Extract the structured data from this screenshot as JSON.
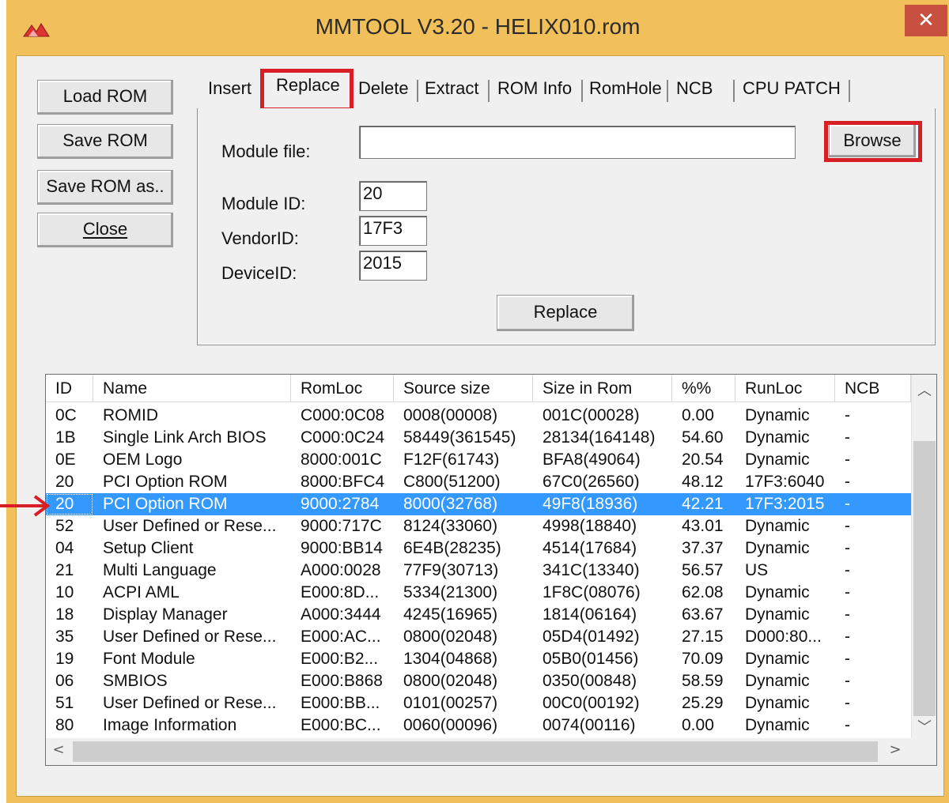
{
  "window": {
    "title": "MMTOOL V3.20 - HELIX010.rom",
    "close_glyph": "✕"
  },
  "left_buttons": {
    "load_rom": "Load ROM",
    "save_rom": "Save ROM",
    "save_rom_as": "Save ROM as..",
    "close": "Close"
  },
  "tabs": [
    {
      "label": "Insert"
    },
    {
      "label": "Replace",
      "active": true,
      "highlighted": true
    },
    {
      "label": "Delete"
    },
    {
      "label": "Extract"
    },
    {
      "label": "ROM Info"
    },
    {
      "label": "RomHole"
    },
    {
      "label": "NCB"
    },
    {
      "label": "CPU PATCH"
    }
  ],
  "replace_panel": {
    "module_file_label": "Module file:",
    "module_file_value": "",
    "browse_label": "Browse",
    "module_id_label": "Module ID:",
    "module_id_value": "20",
    "vendor_id_label": "VendorID:",
    "vendor_id_value": "17F3",
    "device_id_label": "DeviceID:",
    "device_id_value": "2015",
    "replace_button": "Replace"
  },
  "module_table": {
    "columns": [
      "ID",
      "Name",
      "RomLoc",
      "Source size",
      "Size in Rom",
      "%%",
      "RunLoc",
      "NCB"
    ],
    "rows": [
      [
        "0C",
        "ROMID",
        "C000:0C08",
        "0008(00008)",
        "001C(00028)",
        "0.00",
        "Dynamic",
        "-"
      ],
      [
        "1B",
        "Single Link Arch BIOS",
        "C000:0C24",
        "58449(361545)",
        "28134(164148)",
        "54.60",
        "Dynamic",
        "-"
      ],
      [
        "0E",
        "OEM Logo",
        "8000:001C",
        "F12F(61743)",
        "BFA8(49064)",
        "20.54",
        "Dynamic",
        "-"
      ],
      [
        "20",
        "PCI Option ROM",
        "8000:BFC4",
        "C800(51200)",
        "67C0(26560)",
        "48.12",
        "17F3:6040",
        "-"
      ],
      [
        "20",
        "PCI Option ROM",
        "9000:2784",
        "8000(32768)",
        "49F8(18936)",
        "42.21",
        "17F3:2015",
        "-"
      ],
      [
        "52",
        "User Defined or Rese...",
        "9000:717C",
        "8124(33060)",
        "4998(18840)",
        "43.01",
        "Dynamic",
        "-"
      ],
      [
        "04",
        "Setup Client",
        "9000:BB14",
        "6E4B(28235)",
        "4514(17684)",
        "37.37",
        "Dynamic",
        "-"
      ],
      [
        "21",
        "Multi Language",
        "A000:0028",
        "77F9(30713)",
        "341C(13340)",
        "56.57",
        "US",
        "-"
      ],
      [
        "10",
        "ACPI AML",
        "E000:8D...",
        "5334(21300)",
        "1F8C(08076)",
        "62.08",
        "Dynamic",
        "-"
      ],
      [
        "18",
        "Display Manager",
        "A000:3444",
        "4245(16965)",
        "1814(06164)",
        "63.67",
        "Dynamic",
        "-"
      ],
      [
        "35",
        "User Defined or Rese...",
        "E000:AC...",
        "0800(02048)",
        "05D4(01492)",
        "27.15",
        "D000:80...",
        "-"
      ],
      [
        "19",
        "Font Module",
        "E000:B2...",
        "1304(04868)",
        "05B0(01456)",
        "70.09",
        "Dynamic",
        "-"
      ],
      [
        "06",
        "SMBIOS",
        "E000:B868",
        "0800(02048)",
        "0350(00848)",
        "58.59",
        "Dynamic",
        "-"
      ],
      [
        "51",
        "User Defined or Rese...",
        "E000:BB...",
        "0101(00257)",
        "00C0(00192)",
        "25.29",
        "Dynamic",
        "-"
      ],
      [
        "80",
        "Image Information",
        "E000:BC...",
        "0060(00096)",
        "0074(00116)",
        "0.00",
        "Dynamic",
        "-"
      ]
    ],
    "selected_row": 4
  },
  "scrollbars": {
    "up": "︿",
    "down": "﹀",
    "left": "<",
    "right": ">"
  },
  "colors": {
    "frame": "#f2c05a",
    "selection": "#3399ff",
    "annotation": "#d81f26",
    "close": "#c7503f"
  }
}
